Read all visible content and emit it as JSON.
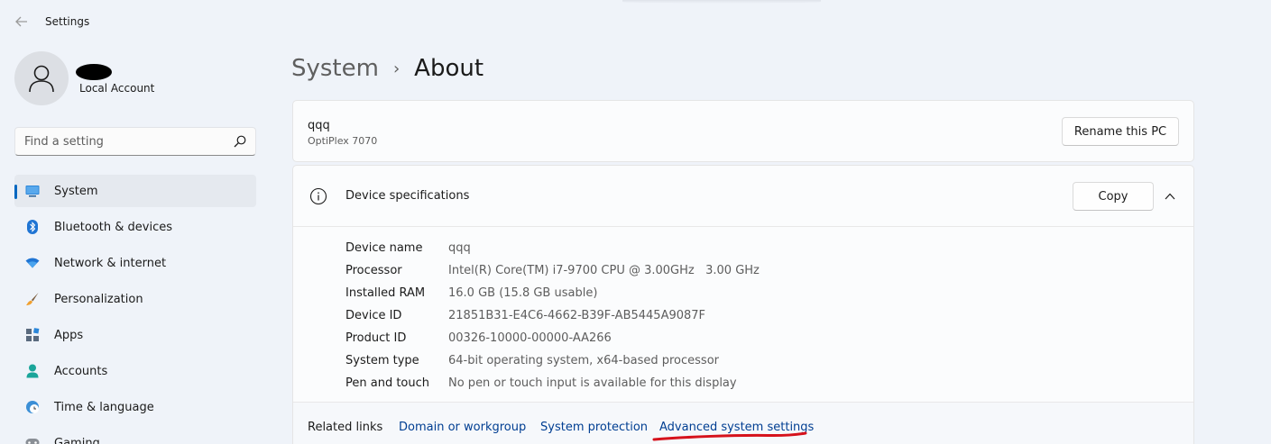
{
  "window": {
    "title": "Settings",
    "back_icon": "back-arrow-icon"
  },
  "account": {
    "type": "Local Account"
  },
  "search": {
    "placeholder": "Find a setting",
    "value": ""
  },
  "sidebar": {
    "items": [
      {
        "label": "System",
        "icon": "system-monitor-icon",
        "active": true
      },
      {
        "label": "Bluetooth & devices",
        "icon": "bluetooth-icon"
      },
      {
        "label": "Network & internet",
        "icon": "wifi-icon"
      },
      {
        "label": "Personalization",
        "icon": "paintbrush-icon"
      },
      {
        "label": "Apps",
        "icon": "apps-icon"
      },
      {
        "label": "Accounts",
        "icon": "person-icon"
      },
      {
        "label": "Time & language",
        "icon": "clock-globe-icon"
      },
      {
        "label": "Gaming",
        "icon": "gamepad-icon"
      }
    ]
  },
  "breadcrumb": {
    "parent": "System",
    "separator": "›",
    "current": "About"
  },
  "pc": {
    "name": "qqq",
    "model": "OptiPlex 7070",
    "rename_label": "Rename this PC"
  },
  "device_specs": {
    "title": "Device specifications",
    "copy_label": "Copy",
    "rows": [
      {
        "label": "Device name",
        "value": "qqq"
      },
      {
        "label": "Processor",
        "value": "Intel(R) Core(TM) i7-9700 CPU @ 3.00GHz   3.00 GHz"
      },
      {
        "label": "Installed RAM",
        "value": "16.0 GB (15.8 GB usable)"
      },
      {
        "label": "Device ID",
        "value": "21851B31-E4C6-4662-B39F-AB5445A9087F"
      },
      {
        "label": "Product ID",
        "value": "00326-10000-00000-AA266"
      },
      {
        "label": "System type",
        "value": "64-bit operating system, x64-based processor"
      },
      {
        "label": "Pen and touch",
        "value": "No pen or touch input is available for this display"
      }
    ]
  },
  "related_links": {
    "title": "Related links",
    "links": [
      {
        "label": "Domain or workgroup"
      },
      {
        "label": "System protection"
      },
      {
        "label": "Advanced system settings"
      }
    ]
  },
  "colors": {
    "accent": "#0067c0",
    "link": "#003e92",
    "annotation": "#d6121c"
  }
}
